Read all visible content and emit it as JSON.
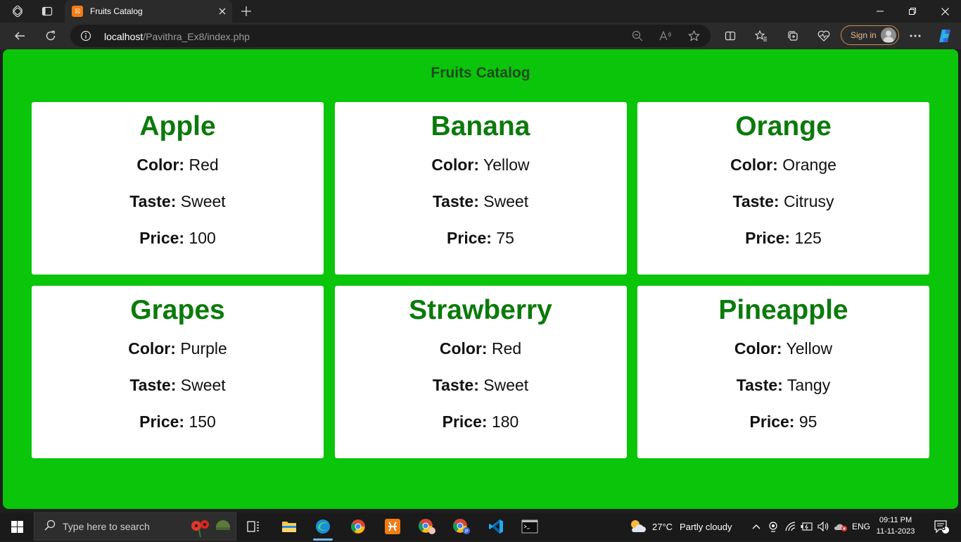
{
  "browser": {
    "tab_title": "Fruits Catalog",
    "url_host": "localhost",
    "url_path": "/Pavithra_Ex8/index.php",
    "signin_label": "Sign in"
  },
  "page": {
    "heading": "Fruits Catalog",
    "labels": {
      "color": "Color:",
      "taste": "Taste:",
      "price": "Price:"
    },
    "fruits": [
      {
        "name": "Apple",
        "color": "Red",
        "taste": "Sweet",
        "price": "100"
      },
      {
        "name": "Banana",
        "color": "Yellow",
        "taste": "Sweet",
        "price": "75"
      },
      {
        "name": "Orange",
        "color": "Orange",
        "taste": "Citrusy",
        "price": "125"
      },
      {
        "name": "Grapes",
        "color": "Purple",
        "taste": "Sweet",
        "price": "150"
      },
      {
        "name": "Strawberry",
        "color": "Red",
        "taste": "Sweet",
        "price": "180"
      },
      {
        "name": "Pineapple",
        "color": "Yellow",
        "taste": "Tangy",
        "price": "95"
      }
    ]
  },
  "taskbar": {
    "search_placeholder": "Type here to search",
    "weather_temp": "27°C",
    "weather_desc": "Partly cloudy",
    "language": "ENG",
    "time": "09:11 PM",
    "date": "11-11-2023",
    "notification_count": "3"
  },
  "colors": {
    "page_background": "#0ac50a",
    "fruit_name": "#0b7a0b",
    "heading": "#1e4a1e"
  }
}
